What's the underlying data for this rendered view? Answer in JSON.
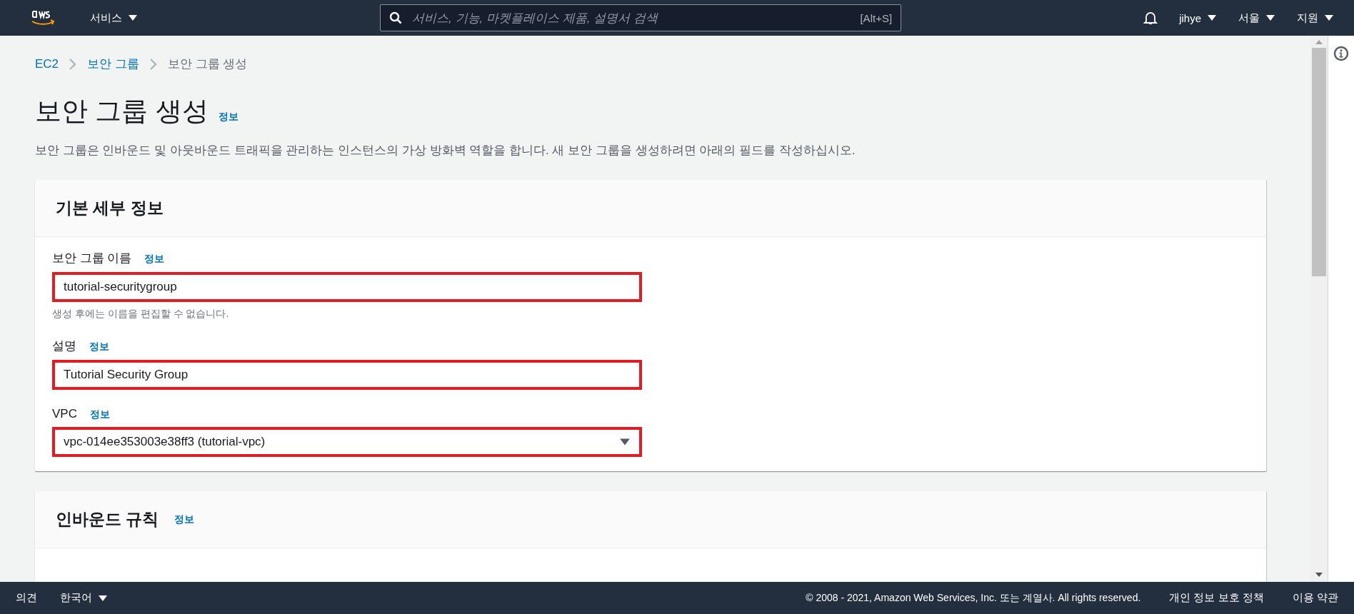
{
  "top_nav": {
    "services_menu": "서비스",
    "search": {
      "placeholder": "서비스, 기능, 마켓플레이스 제품, 설명서 검색",
      "shortcut": "[Alt+S]"
    },
    "menus": [
      "jihye",
      "서울",
      "지원"
    ]
  },
  "breadcrumb": [
    {
      "label": "EC2",
      "link": true
    },
    {
      "label": "보안 그룹",
      "link": true
    },
    {
      "label": "보안 그룹 생성",
      "link": false
    }
  ],
  "page": {
    "title": "보안 그룹 생성",
    "info": "정보",
    "description": "보안 그룹은 인바운드 및 아웃바운드 트래픽을 관리하는 인스턴스의 가상 방화벽 역할을 합니다. 새 보안 그룹을 생성하려면 아래의 필드를 작성하십시오."
  },
  "basic_details": {
    "title": "기본 세부 정보",
    "fields": [
      {
        "kind": "text",
        "label": "보안 그룹 이름",
        "info": "정보",
        "value": "tutorial-securitygroup",
        "hint": "생성 후에는 이름을 편집할 수 없습니다.",
        "highlighted": true
      },
      {
        "kind": "text",
        "label": "설명",
        "info": "정보",
        "value": "Tutorial Security Group",
        "highlighted": true
      },
      {
        "kind": "select",
        "label": "VPC",
        "info": "정보",
        "value": "vpc-014ee353003e38ff3 (tutorial-vpc)",
        "highlighted": true
      }
    ]
  },
  "inbound_rules": {
    "title": "인바운드 규칙",
    "info": "정보"
  },
  "footer": {
    "feedback": "의견",
    "language": "한국어",
    "copyright": "© 2008 - 2021, Amazon Web Services, Inc. 또는 계열사. All rights reserved.",
    "links": [
      "개인 정보 보호 정책",
      "이용 약관"
    ]
  }
}
